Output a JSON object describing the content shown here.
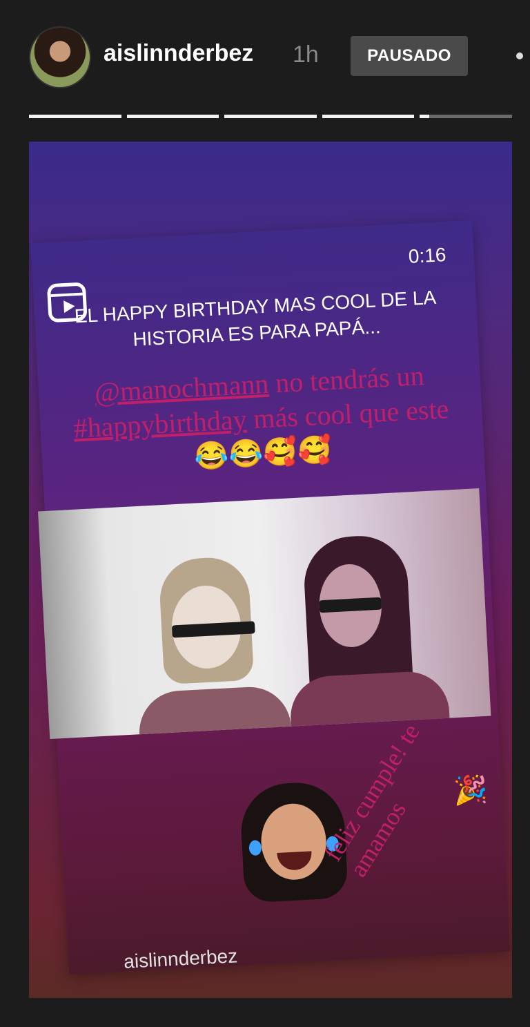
{
  "header": {
    "username": "aislinnderbez",
    "time_ago": "1h",
    "paused_label": "PAUSADO",
    "progress": {
      "segments": 5,
      "current_segment": 5,
      "current_fraction": 0.1
    }
  },
  "reel": {
    "duration": "0:16",
    "caption": "EL HAPPY BIRTHDAY MAS COOL DE LA HISTORIA ES PARA PAPÁ..."
  },
  "caption_text": {
    "mention": "@manochmann",
    "part1": " no tendrás un ",
    "hashtag": "#happybirthday",
    "part2": " más cool que este ",
    "emojis": "😂😂🥰🥰"
  },
  "feliz_text": "feliz cumple! te amamos",
  "party_emoji": "🎉",
  "watermark": "aislinnderbez",
  "colors": {
    "accent_pink": "#c0206a",
    "background": "#1c1c1c"
  }
}
